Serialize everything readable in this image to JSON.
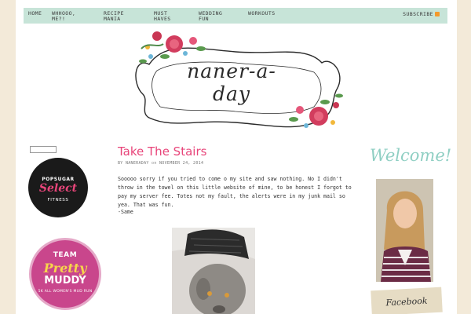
{
  "nav": {
    "items": [
      {
        "label": "HOME",
        "line2": ""
      },
      {
        "label": "WHHOOO,",
        "line2": "ME?!"
      },
      {
        "label": "RECIPE",
        "line2": "MANIA"
      },
      {
        "label": "MUST",
        "line2": "HAVES"
      },
      {
        "label": "WEDDING",
        "line2": "FUN"
      },
      {
        "label": "WORKOUTS",
        "line2": ""
      }
    ],
    "subscribe": "SUBSCRIBE",
    "subscribe_icon": "rss-icon"
  },
  "header": {
    "logo_text": "naner-a-day"
  },
  "sidebar_left": {
    "popsugar": {
      "top": "POPSUGAR",
      "mid": "Select",
      "bot": "FITNESS"
    },
    "muddy": {
      "l1": "TEAM",
      "l2": "Pretty",
      "l3": "MUDDY",
      "l4": "5K ALL WOMEN'S MUD RUN"
    }
  },
  "post": {
    "title": "Take The Stairs",
    "meta_by": "by",
    "meta_author": "NANERADAY",
    "meta_on": "on",
    "meta_date": "NOVEMBER 24, 2014",
    "body": "Sooooo sorry if you tried to come o my site and saw nothing.  No I didn't throw in the towel on this little website of mine, to be honest I forgot to pay my server fee.  Totes not my fault, the alerts were in my junk mail so yea.  That was fun.",
    "signature": "-Same"
  },
  "sidebar_right": {
    "welcome": "Welcome!",
    "facebook": "Facebook"
  },
  "colors": {
    "accent_pink": "#e8457a",
    "nav_mint": "#c7e4d8",
    "welcome_teal": "#8fcfc3"
  }
}
